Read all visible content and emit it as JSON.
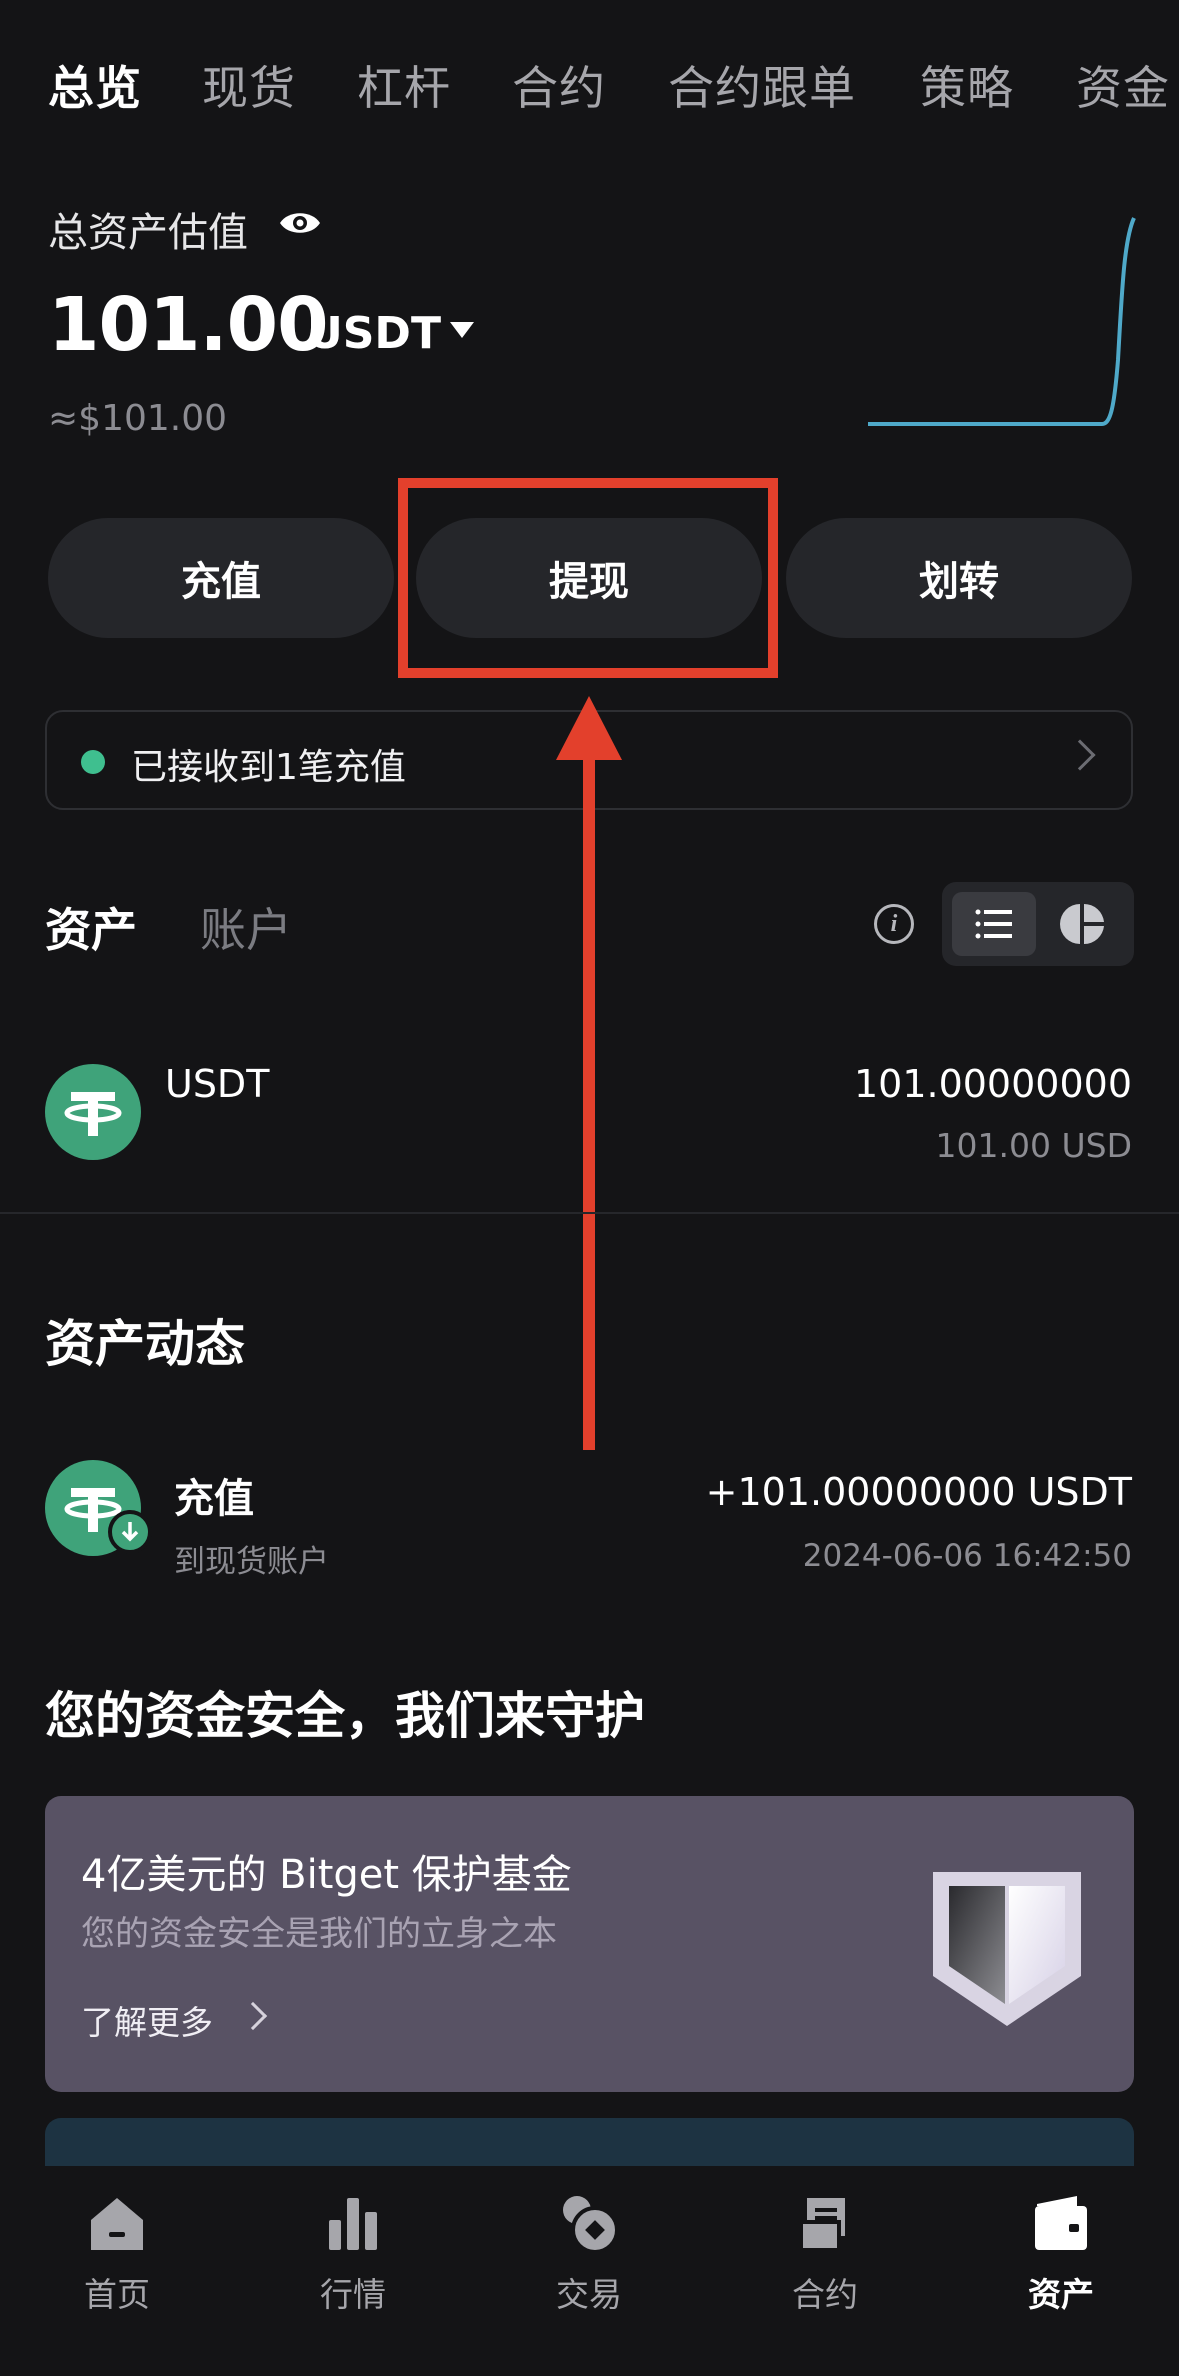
{
  "top_tabs": [
    "总览",
    "现货",
    "杠杆",
    "合约",
    "合约跟单",
    "策略",
    "资金"
  ],
  "summary": {
    "label": "总资产估值",
    "balance": "101.00",
    "unit": "USDT",
    "approx": "≈$101.00"
  },
  "actions": {
    "deposit": "充值",
    "withdraw": "提现",
    "transfer": "划转"
  },
  "notice": {
    "text": "已接收到1笔充值"
  },
  "asset_tabs": {
    "assets": "资产",
    "accounts": "账户"
  },
  "assets": [
    {
      "name": "USDT",
      "amount": "101.00000000",
      "usd": "101.00 USD"
    }
  ],
  "activity": {
    "title": "资产动态",
    "items": [
      {
        "title": "充值",
        "subtitle": "到现货账户",
        "amount": "+101.00000000 USDT",
        "time": "2024-06-06 16:42:50"
      }
    ]
  },
  "security": {
    "title": "您的资金安全，我们来守护",
    "promo_title": "4亿美元的 Bitget 保护基金",
    "promo_sub": "您的资金安全是我们的立身之本",
    "promo_link": "了解更多"
  },
  "bottom_nav": [
    {
      "label": "首页",
      "icon": "home-icon"
    },
    {
      "label": "行情",
      "icon": "chart-bars-icon"
    },
    {
      "label": "交易",
      "icon": "trade-icon"
    },
    {
      "label": "合约",
      "icon": "contract-icon"
    },
    {
      "label": "资产",
      "icon": "wallet-icon"
    }
  ],
  "colors": {
    "background": "#141416",
    "accent_green": "#3fbf8f",
    "annotation_red": "#e3402c",
    "sparkline": "#4fa9c9"
  }
}
